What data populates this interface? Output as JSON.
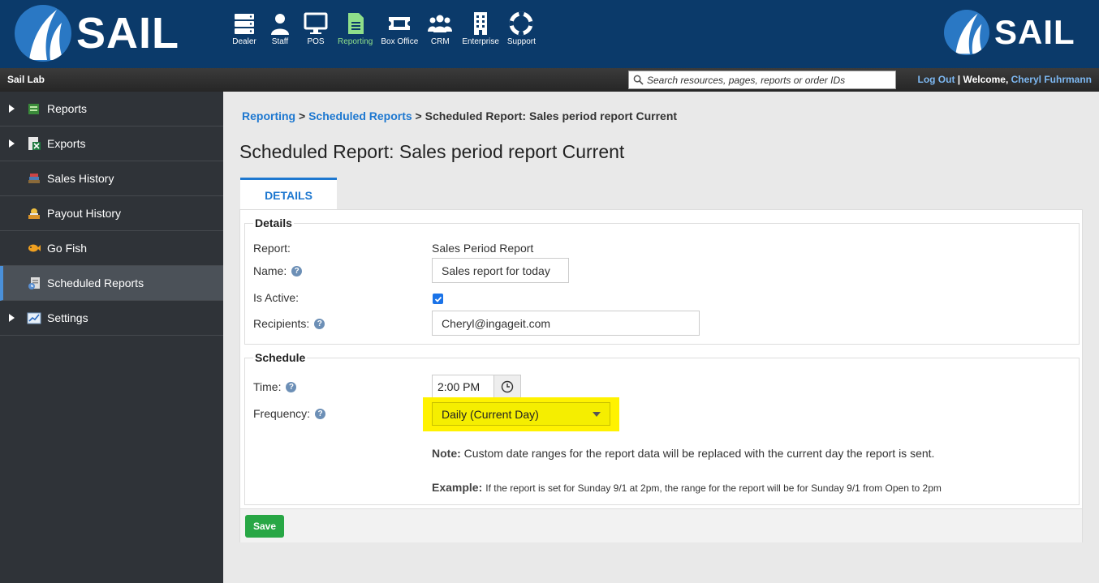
{
  "header": {
    "logo_text": "SAIL",
    "nav": [
      {
        "label": "Dealer",
        "icon": "server-icon"
      },
      {
        "label": "Staff",
        "icon": "person-icon"
      },
      {
        "label": "POS",
        "icon": "monitor-icon"
      },
      {
        "label": "Reporting",
        "icon": "document-icon",
        "active": true
      },
      {
        "label": "Box Office",
        "icon": "ticket-icon"
      },
      {
        "label": "CRM",
        "icon": "group-icon"
      },
      {
        "label": "Enterprise",
        "icon": "building-icon"
      },
      {
        "label": "Support",
        "icon": "lifebuoy-icon"
      }
    ],
    "active_color": "#8fdf8a",
    "bg_color": "#0b3a6a"
  },
  "subbar": {
    "site_name": "Sail Lab",
    "search_placeholder": "Search resources, pages, reports or order IDs",
    "logout": "Log Out",
    "separator": " | ",
    "welcome": "Welcome, ",
    "user_name": "Cheryl Fuhrmann"
  },
  "sidebar": {
    "items": [
      {
        "label": "Reports",
        "expandable": true,
        "icon": "reports-icon"
      },
      {
        "label": "Exports",
        "expandable": true,
        "icon": "excel-export-icon"
      },
      {
        "label": "Sales History",
        "expandable": false,
        "icon": "books-icon"
      },
      {
        "label": "Payout History",
        "expandable": false,
        "icon": "payout-icon"
      },
      {
        "label": "Go Fish",
        "expandable": false,
        "icon": "fish-icon"
      },
      {
        "label": "Scheduled Reports",
        "expandable": false,
        "icon": "schedule-icon",
        "active": true
      },
      {
        "label": "Settings",
        "expandable": true,
        "icon": "settings-chart-icon"
      }
    ]
  },
  "breadcrumb": {
    "items": [
      "Reporting",
      "Scheduled Reports"
    ],
    "separator": " > ",
    "current": "Scheduled Report: Sales period report Current"
  },
  "page_title": "Scheduled Report: Sales period report Current",
  "tab": {
    "label": "DETAILS"
  },
  "details": {
    "legend": "Details",
    "report_label": "Report:",
    "report_value": "Sales Period Report",
    "name_label": "Name:",
    "name_value": "Sales report for today",
    "is_active_label": "Is Active:",
    "is_active": true,
    "recipients_label": "Recipients:",
    "recipients_value": "Cheryl@ingageit.com"
  },
  "schedule": {
    "legend": "Schedule",
    "time_label": "Time:",
    "time_value": "2:00 PM",
    "frequency_label": "Frequency:",
    "frequency_value": "Daily (Current Day)",
    "highlight_color": "#fff200",
    "note_label": "Note:",
    "note_text": " Custom date ranges for the report data will be replaced with the current day the report is sent.",
    "example_label": "Example:",
    "example_text": "If the report is set for Sunday 9/1 at 2pm, the range for the report will be for Sunday 9/1 from Open to 2pm"
  },
  "save_label": "Save"
}
